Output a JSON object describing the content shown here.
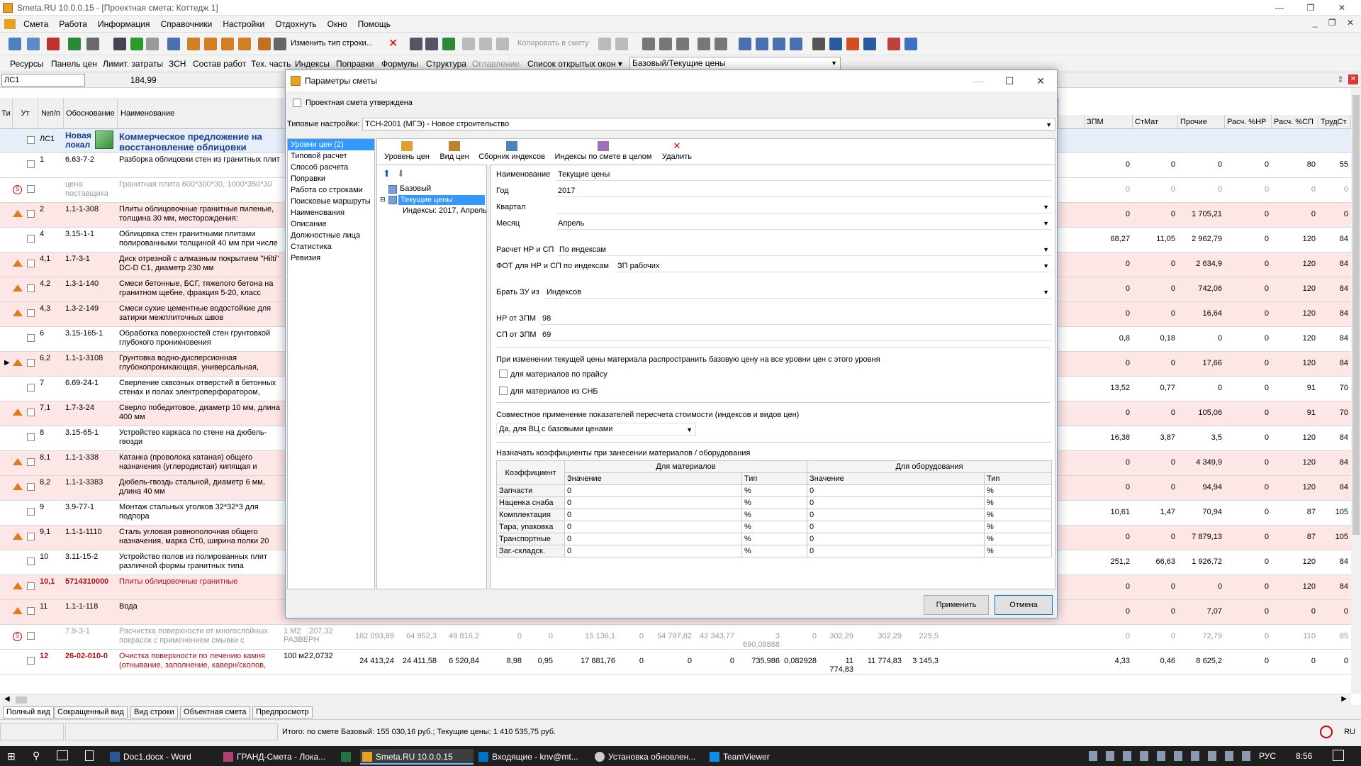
{
  "window": {
    "title": "Smeta.RU  10.0.0.15  - [Проектная смета: Коттедж 1]"
  },
  "menu": [
    "Смета",
    "Работа",
    "Информация",
    "Справочники",
    "Настройки",
    "Отдохнуть",
    "Окно",
    "Помощь"
  ],
  "toolbar1": {
    "change_type": "Изменить тип строки...",
    "copy_to_estimate": "Копировать в смету"
  },
  "toolbar2": {
    "items": [
      "Ресурсы",
      "Панель цен",
      "Лимит. затраты",
      "ЗСН",
      "Состав работ",
      "Тех. часть",
      "Индексы",
      "Поправки",
      "Формулы",
      "Структура",
      "Оглавление",
      "Список открытых окон ▾"
    ],
    "combo": "Базовый/Текущие цены"
  },
  "addr": {
    "cell": "ЛС1",
    "value": "184,99"
  },
  "grid": {
    "headers": {
      "ti": "Ти",
      "ut": "Ут",
      "num": "№п/п",
      "basis": "Обоснование",
      "name": "Наименование"
    },
    "right_headers": [
      "ЗПМ",
      "СтМат",
      "Прочие",
      "Расч. %НР",
      "Расч. %СП",
      "ТрудСт"
    ],
    "section": {
      "code": "ЛС1",
      "basis": "Новая локал",
      "name": "Коммерческое предложение на восстановление облицовки"
    },
    "rows": [
      {
        "n": "1",
        "basis": "6.63-7-2",
        "name": "Разборка облицовки стен из гранитных плит",
        "v": [
          "0",
          "0",
          "0",
          "0",
          "80",
          "55"
        ],
        "cls": "white",
        "m": ""
      },
      {
        "n": "",
        "basis": "цена поставщика",
        "name": "Гранитная плита 600*300*30, 1000*350*30",
        "v": [
          "0",
          "0",
          "0",
          "0",
          "0",
          "0"
        ],
        "cls": "white",
        "m": "stop",
        "grey": true
      },
      {
        "n": "2",
        "basis": "1.1-1-308",
        "name": "Плиты облицовочные гранитные пиленые, толщина 30 мм, месторождения:",
        "v": [
          "0",
          "0",
          "1 705,21",
          "0",
          "0",
          "0"
        ],
        "cls": "pink",
        "m": "tri"
      },
      {
        "n": "4",
        "basis": "3.15-1-1",
        "name": "Облицовка стен гранитными плитами полированными толщиной 40 мм при числе",
        "v": [
          "68,27",
          "11,05",
          "2 962,79",
          "0",
          "120",
          "84"
        ],
        "cls": "white",
        "m": ""
      },
      {
        "n": "4,1",
        "basis": "1.7-3-1",
        "name": "Диск отрезной с алмазным покрытием \"Hilti\" DC-D C1, диаметр 230 мм",
        "v": [
          "0",
          "0",
          "2 634,9",
          "0",
          "120",
          "84"
        ],
        "cls": "pink",
        "m": "tri"
      },
      {
        "n": "4,2",
        "basis": "1.3-1-140",
        "name": "Смеси бетонные, БСГ, тяжелого бетона на гранитном щебне, фракция 5-20, класс",
        "v": [
          "0",
          "0",
          "742,06",
          "0",
          "120",
          "84"
        ],
        "cls": "pink",
        "m": "tri"
      },
      {
        "n": "4,3",
        "basis": "1.3-2-149",
        "name": "Смеси сухие цементные водостойкие для затирки межплиточных швов",
        "v": [
          "0",
          "0",
          "16,64",
          "0",
          "120",
          "84"
        ],
        "cls": "pink",
        "m": "tri"
      },
      {
        "n": "6",
        "basis": "3.15-165-1",
        "name": "Обработка поверхностей стен грунтовкой глубокого проникновения",
        "v": [
          "0,8",
          "0,18",
          "0",
          "0",
          "120",
          "84"
        ],
        "cls": "white",
        "m": ""
      },
      {
        "n": "6,2",
        "basis": "1.1-1-3108",
        "name": "Грунтовка водно-дисперсионная глубокопроникающая, универсальная,",
        "v": [
          "0",
          "0",
          "17,66",
          "0",
          "120",
          "84"
        ],
        "cls": "pink",
        "m": "tri"
      },
      {
        "n": "7",
        "basis": "6.69-24-1",
        "name": "Сверление сквозных отверстий в бетонных стенах и полах электроперфоратором,",
        "v": [
          "13,52",
          "0,77",
          "0",
          "0",
          "91",
          "70"
        ],
        "cls": "white",
        "m": ""
      },
      {
        "n": "7,1",
        "basis": "1.7-3-24",
        "name": "Сверло победитовое, диаметр 10 мм, длина 400 мм",
        "v": [
          "0",
          "0",
          "105,06",
          "0",
          "91",
          "70"
        ],
        "cls": "pink",
        "m": "tri"
      },
      {
        "n": "8",
        "basis": "3.15-65-1",
        "name": "Устройство каркаса по стене на дюбель-гвозди",
        "v": [
          "16,38",
          "3,87",
          "3,5",
          "0",
          "120",
          "84"
        ],
        "cls": "white",
        "m": ""
      },
      {
        "n": "8,1",
        "basis": "1.1-1-338",
        "name": "Катанка (проволока катаная) общего назначения (углеродистая) кипящая и",
        "v": [
          "0",
          "0",
          "4 349,9",
          "0",
          "120",
          "84"
        ],
        "cls": "pink",
        "m": "tri"
      },
      {
        "n": "8,2",
        "basis": "1.1-1-3383",
        "name": "Дюбель-гвоздь стальной, диаметр 6 мм, длина 40 мм",
        "v": [
          "0",
          "0",
          "94,94",
          "0",
          "120",
          "84"
        ],
        "cls": "pink",
        "m": "tri"
      },
      {
        "n": "9",
        "basis": "3.9-77-1",
        "name": "Монтаж стальных уголков 32*32*3 для подпора",
        "v": [
          "10,61",
          "1,47",
          "70,94",
          "0",
          "87",
          "105"
        ],
        "cls": "white",
        "m": ""
      },
      {
        "n": "9,1",
        "basis": "1.1-1-1110",
        "name": "Сталь угловая равнополочная общего назначения, марка Ст0, ширина полки 20",
        "v": [
          "0",
          "0",
          "7 879,13",
          "0",
          "87",
          "105"
        ],
        "cls": "pink",
        "m": "tri"
      },
      {
        "n": "10",
        "basis": "3.11-15-2",
        "name": "Устройство полов из полированных плит различной формы гранитных типа",
        "v": [
          "251,2",
          "66,63",
          "1 926,72",
          "0",
          "120",
          "84"
        ],
        "cls": "white",
        "m": ""
      },
      {
        "n": "10,1",
        "basis": "5714310000",
        "name": "Плиты облицовочные гранитные",
        "v": [
          "0",
          "0",
          "0",
          "0",
          "120",
          "84"
        ],
        "cls": "pink",
        "m": "tri",
        "red": true
      },
      {
        "n": "11",
        "basis": "1.1-1-118",
        "name": "Вода",
        "v": [
          "0",
          "0",
          "7,07",
          "0",
          "0",
          "0"
        ],
        "cls": "pink",
        "m": "tri"
      },
      {
        "n": "",
        "basis": "7.9-3-1",
        "name": "Расчистка поверхности от многослойных покрасок с применением смывки с",
        "v": [
          "0",
          "0",
          "72,79",
          "0",
          "110",
          "85"
        ],
        "cls": "white",
        "m": "stop",
        "grey": true,
        "extra": [
          "1 М2 РАЗВЕРН",
          "207,32",
          "162 093,89",
          "64 952,3",
          "49 816,2",
          "0",
          "0",
          "15 136,1",
          "0",
          "54 797,82",
          "42 343,77",
          "3 690,08868",
          "0",
          "302,29",
          "302,29",
          "229,5"
        ]
      },
      {
        "n": "12",
        "basis": "26-02-010-0",
        "name": "Очистка поверхности по лечению камня (отнывание, заполнение, каверн/сколов,",
        "v": [
          "4,33",
          "0,46",
          "8 625,2",
          "0",
          "0",
          "0"
        ],
        "cls": "white",
        "m": "",
        "red": true,
        "extra": [
          "100 м2",
          "2,0732",
          "24 413,24",
          "24 411,58",
          "6 520,84",
          "8,98",
          "0,95",
          "17 881,76",
          "0",
          "0",
          "0",
          "735,986",
          "0,082928",
          "11 774,83",
          "11 774,83",
          "3 145,3"
        ]
      }
    ]
  },
  "bottom_tabs": [
    "Полный вид",
    "Сокращенный вид",
    "Вид строки",
    "Объектная смета",
    "Предпросмотр"
  ],
  "status": {
    "text": "Итого: по смете Базовый: 155 030,16 руб.; Текущие цены: 1 410 535,75 руб.",
    "lang": "RU"
  },
  "taskbar": {
    "items": [
      "Doc1.docx - Word",
      "ГРАНД-Смета - Лока...",
      "Smeta.RU  10.0.0.15",
      "Входящие - knv@mt...",
      "Установка обновлен...",
      "TeamViewer"
    ],
    "lang": "РУС",
    "time": "8:56"
  },
  "dialog": {
    "title": "Параметры сметы",
    "approved_label": "Проектная смета утверждена",
    "typical_label": "Типовые настройки:",
    "typical_value": "ТСН-2001 (МГЭ) - Новое строительство",
    "left_list": [
      "Уровни цен (2)",
      "Типовой расчет",
      "Способ расчета",
      "Поправки",
      "Работа со строками",
      "Поисковые маршруты",
      "Наименования",
      "Описание",
      "Должностные лица",
      "Статистика",
      "Ревизия"
    ],
    "subtoolbar": [
      "Уровень цен",
      "Вид цен",
      "Сборник индексов",
      "Индексы по смете в целом",
      "Удалить"
    ],
    "tree": {
      "base": "Базовый",
      "current": "Текущие цены",
      "indexes": "Индексы: 2017, Апрель"
    },
    "form": {
      "name_label": "Наименование",
      "name_value": "Текущие цены",
      "year_label": "Год",
      "year_value": "2017",
      "quarter_label": "Квартал",
      "quarter_value": "",
      "month_label": "Месяц",
      "month_value": "Апрель",
      "nrsp_label": "Расчет НР и СП",
      "nrsp_value": "По индексам",
      "fot_label": "ФОТ для НР и СП по индексам",
      "fot_value": "ЗП рабочих",
      "zu_label": "Брать ЗУ из",
      "zu_value": "Индексов",
      "nr_label": "НР от ЗПМ",
      "nr_value": "98",
      "sp_label": "СП от ЗПМ",
      "sp_value": "69",
      "spread_text": "При изменении текущей цены материала распространить базовую цену на все уровни цен с этого уровня",
      "price_list_label": "для материалов по прайсу",
      "snb_label": "для материалов из СНБ",
      "joint_text": "Совместное применение показателей пересчета стоимости (индексов и видов цен)",
      "joint_value": "Да, для ВЦ с базовыми ценами",
      "coef_text": "Назначать коэффициенты при занесении материалов / оборудования"
    },
    "coef_table": {
      "h_coef": "Коэффициент",
      "h_mat": "Для материалов",
      "h_eq": "Для оборудования",
      "h_val": "Значение",
      "h_type": "Тип",
      "rows": [
        {
          "name": "Запчасти",
          "mv": "0",
          "mt": "%",
          "ev": "0",
          "et": "%"
        },
        {
          "name": "Наценка снаба",
          "mv": "0",
          "mt": "%",
          "ev": "0",
          "et": "%"
        },
        {
          "name": "Комплектация",
          "mv": "0",
          "mt": "%",
          "ev": "0",
          "et": "%"
        },
        {
          "name": "Тара, упаковка",
          "mv": "0",
          "mt": "%",
          "ev": "0",
          "et": "%"
        },
        {
          "name": "Транспортные",
          "mv": "0",
          "mt": "%",
          "ev": "0",
          "et": "%"
        },
        {
          "name": "Заг.-складск.",
          "mv": "0",
          "mt": "%",
          "ev": "0",
          "et": "%"
        }
      ]
    },
    "apply_label": "Применить",
    "cancel_label": "Отмена"
  }
}
